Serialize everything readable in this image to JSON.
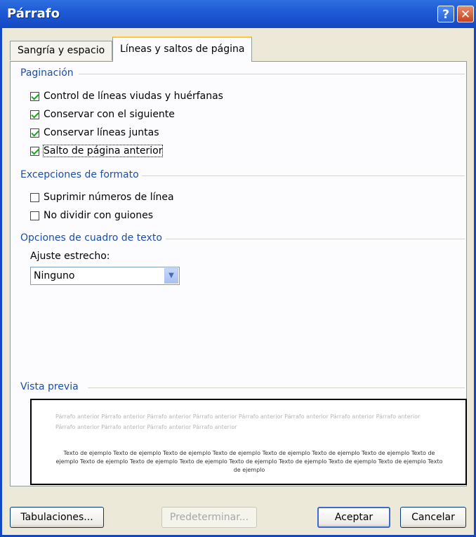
{
  "window": {
    "title": "Párrafo",
    "help_label": "?",
    "close_label": "✕"
  },
  "tabs": [
    {
      "label": "Sangría y espacio",
      "active": false
    },
    {
      "label": "Líneas y saltos de página",
      "active": true
    }
  ],
  "pagination": {
    "title": "Paginación",
    "options": [
      {
        "label": "Control de líneas viudas y huérfanas",
        "checked": true
      },
      {
        "label": "Conservar con el siguiente",
        "checked": true
      },
      {
        "label": "Conservar líneas juntas",
        "checked": true
      },
      {
        "label": "Salto de página anterior",
        "checked": true
      }
    ]
  },
  "format_exceptions": {
    "title": "Excepciones de formato",
    "options": [
      {
        "label": "Suprimir números de línea",
        "checked": false
      },
      {
        "label": "No dividir con guiones",
        "checked": false
      }
    ]
  },
  "textbox_options": {
    "title": "Opciones de cuadro de texto",
    "tight_wrap_label": "Ajuste estrecho:",
    "tight_wrap_value": "Ninguno"
  },
  "preview": {
    "title": "Vista previa",
    "prior_paragraph": "Párrafo anterior Párrafo anterior Párrafo anterior Párrafo anterior Párrafo anterior Párrafo anterior Párrafo anterior Párrafo anterior Párrafo anterior Párrafo anterior Párrafo anterior Párrafo anterior",
    "sample_text": "Texto de ejemplo Texto de ejemplo Texto de ejemplo Texto de ejemplo Texto de ejemplo Texto de ejemplo Texto de ejemplo Texto de ejemplo Texto de ejemplo Texto de ejemplo Texto de ejemplo Texto de ejemplo Texto de ejemplo Texto de ejemplo Texto de ejemplo Texto de ejemplo"
  },
  "buttons": {
    "tabs": "Tabulaciones...",
    "default": "Predeterminar...",
    "ok": "Aceptar",
    "cancel": "Cancelar"
  },
  "colors": {
    "title_bar": "#1F5BD6",
    "section_header": "#1B4EA8",
    "active_tab_accent": "#FFC83C",
    "checkmark": "#21A121"
  }
}
